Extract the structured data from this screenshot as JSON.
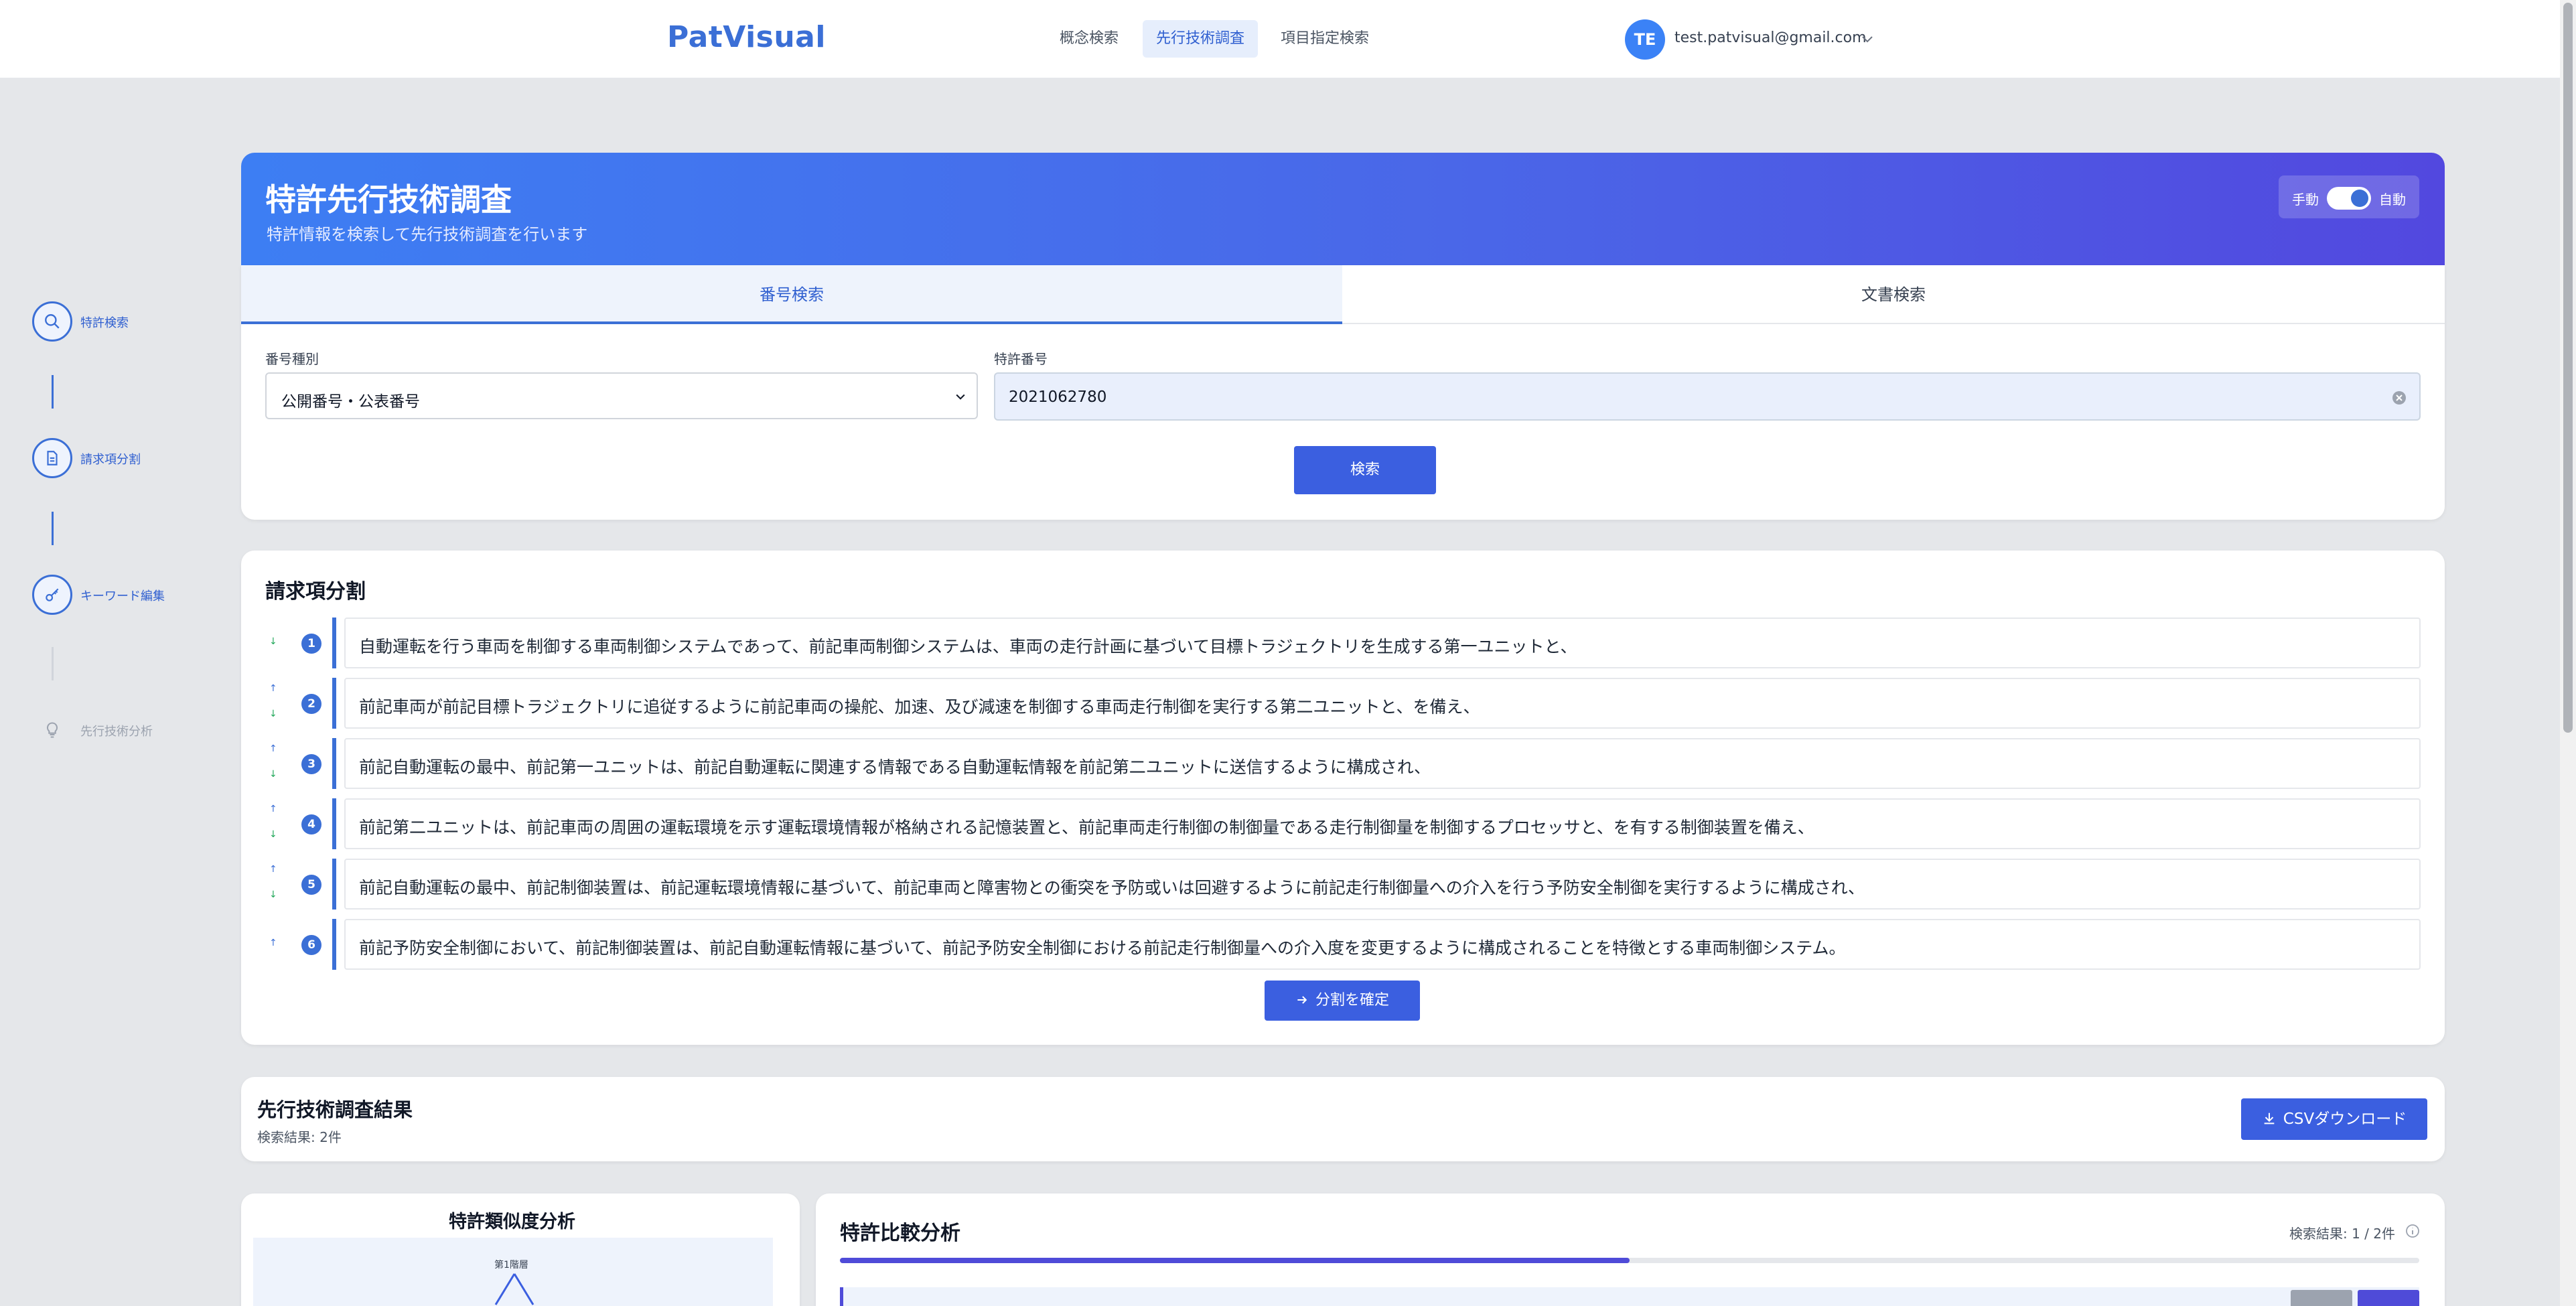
{
  "header": {
    "logo": "PatVisual",
    "nav": [
      "概念検索",
      "先行技術調査",
      "項目指定検索"
    ],
    "active_nav": "先行技術調査",
    "user_initials": "TE",
    "user_email": "test.patvisual@gmail.com"
  },
  "steps": [
    {
      "label": "特許検索",
      "icon": "search-icon",
      "state": "active"
    },
    {
      "label": "請求項分割",
      "icon": "document-icon",
      "state": "active"
    },
    {
      "label": "キーワード編集",
      "icon": "key-icon",
      "state": "active"
    },
    {
      "label": "先行技術分析",
      "icon": "lightbulb-icon",
      "state": "disabled"
    }
  ],
  "hero": {
    "title": "特許先行技術調査",
    "subtitle": "特許情報を検索して先行技術調査を行います",
    "mode_manual": "手動",
    "mode_auto": "自動",
    "mode_auto_enabled": true
  },
  "search": {
    "tabs": [
      "番号検索",
      "文書検索"
    ],
    "active_tab": "番号検索",
    "number_type_label": "番号種別",
    "number_type_value": "公開番号・公表番号",
    "patent_number_label": "特許番号",
    "patent_number_value": "2021062780",
    "search_button": "検索"
  },
  "claims": {
    "title": "請求項分割",
    "items": [
      {
        "num": "1",
        "text": "自動運転を行う車両を制御する車両制御システムであって、前記車両制御システムは、車両の走行計画に基づいて目標トラジェクトリを生成する第一ユニットと、"
      },
      {
        "num": "2",
        "text": "前記車両が前記目標トラジェクトリに追従するように前記車両の操舵、加速、及び減速を制御する車両走行制御を実行する第二ユニットと、を備え、"
      },
      {
        "num": "3",
        "text": "前記自動運転の最中、前記第一ユニットは、前記自動運転に関連する情報である自動運転情報を前記第二ユニットに送信するように構成され、"
      },
      {
        "num": "4",
        "text": "前記第二ユニットは、前記車両の周囲の運転環境を示す運転環境情報が格納される記憶装置と、前記車両走行制御の制御量である走行制御量を制御するプロセッサと、を有する制御装置を備え、"
      },
      {
        "num": "5",
        "text": "前記自動運転の最中、前記制御装置は、前記運転環境情報に基づいて、前記車両と障害物との衝突を予防或いは回避するように前記走行制御量への介入を行う予防安全制御を実行するように構成され、"
      },
      {
        "num": "6",
        "text": "前記予防安全制御において、前記制御装置は、前記自動運転情報に基づいて、前記予防安全制御における前記走行制御量への介入度を変更するように構成されることを特徴とする車両制御システム。"
      }
    ],
    "confirm_button": "分割を確定"
  },
  "results": {
    "title": "先行技術調査結果",
    "count_text": "検索結果: 2件",
    "csv_button": "CSVダウンロード"
  },
  "similarity": {
    "title": "特許類似度分析",
    "axis_label": "第1階層"
  },
  "comparison": {
    "title": "特許比較分析",
    "count_text": "検索結果: 1 / 2件",
    "progress": 0.5
  },
  "colors": {
    "accent": "#3b6fd6",
    "hero_start": "#3d7ef3",
    "hero_end": "#5248df",
    "primary_button": "#3b5fe0"
  }
}
